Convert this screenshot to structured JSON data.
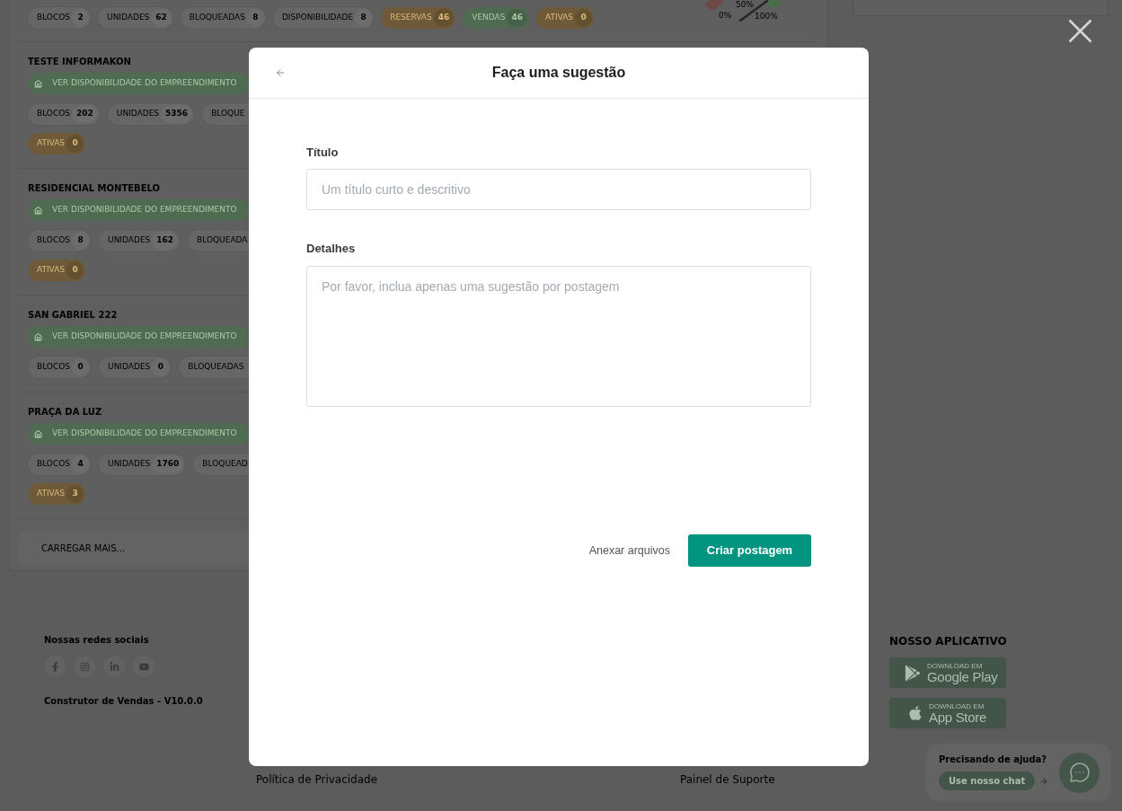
{
  "background_page": {
    "summary_chips": [
      {
        "label": "BLOCOS",
        "value": "2",
        "kind": "neutral"
      },
      {
        "label": "UNIDADES",
        "value": "62",
        "kind": "neutral"
      },
      {
        "label": "BLOQUEADAS",
        "value": "8",
        "kind": "neutral"
      },
      {
        "label": "DISPONIBILIDADE",
        "value": "8",
        "kind": "neutral"
      },
      {
        "label": "RESERVAS",
        "value": "46",
        "kind": "warning"
      },
      {
        "label": "VENDAS",
        "value": "46",
        "kind": "success"
      },
      {
        "label": "ATIVAS",
        "value": "0",
        "kind": "warning"
      }
    ],
    "gauge_labels": [
      "50%",
      "0%",
      "100%"
    ],
    "projects": [
      {
        "name": "TESTE INFORMAKON",
        "action": "VER DISPONIBILIDADE DO EMPREENDIMENTO",
        "chips": [
          {
            "label": "BLOCOS",
            "value": "202",
            "kind": "neutral"
          },
          {
            "label": "UNIDADES",
            "value": "5356",
            "kind": "neutral"
          },
          {
            "label": "BLOQUE",
            "kind": "neutral"
          }
        ],
        "status_chips": [
          {
            "label": "ATIVAS",
            "value": "0",
            "kind": "warning"
          }
        ]
      },
      {
        "name": "RESIDENCIAL MONTEBELO",
        "action": "VER DISPONIBILIDADE DO EMPREENDIMENTO",
        "chips": [
          {
            "label": "BLOCOS",
            "value": "8",
            "kind": "neutral"
          },
          {
            "label": "UNIDADES",
            "value": "162",
            "kind": "neutral"
          },
          {
            "label": "BLOQUEADA",
            "kind": "neutral"
          }
        ],
        "status_chips": [
          {
            "label": "ATIVAS",
            "value": "0",
            "kind": "warning"
          }
        ]
      },
      {
        "name": "SAN GABRIEL 222",
        "action": "VER DISPONIBILIDADE DO EMPREENDIMENTO",
        "chips": [
          {
            "label": "BLOCOS",
            "value": "0",
            "kind": "neutral"
          },
          {
            "label": "UNIDADES",
            "value": "0",
            "kind": "neutral"
          },
          {
            "label": "BLOQUEADAS",
            "kind": "neutral"
          }
        ]
      },
      {
        "name": "PRAÇA DA LUZ",
        "action": "VER DISPONIBILIDADE DO EMPREENDIMENTO",
        "chips": [
          {
            "label": "BLOCOS",
            "value": "4",
            "kind": "neutral"
          },
          {
            "label": "UNIDADES",
            "value": "1760",
            "kind": "neutral"
          },
          {
            "label": "BLOQUEAD",
            "kind": "neutral"
          }
        ],
        "status_chips": [
          {
            "label": "ATIVAS",
            "value": "3",
            "kind": "warning"
          }
        ]
      }
    ],
    "load_more": "CARREGAR MAIS..."
  },
  "footer": {
    "social_title": "Nossas redes sociais",
    "version": "Construtor de Vendas - V10.0.0",
    "app_title": "NOSSO APLICATIVO",
    "stores": [
      {
        "kind": "google_play",
        "caption": "DOWNLOAD EM",
        "name": "Google Play"
      },
      {
        "kind": "app_store",
        "caption": "DOWNLOAD EM",
        "name": "App Store"
      }
    ],
    "links": [
      "Política de Privacidade",
      "Painel de Suporte"
    ]
  },
  "chat_widget": {
    "prompt": "Precisando de ajuda?",
    "button": "Use nosso chat"
  },
  "modal": {
    "title": "Faça uma sugestão",
    "fields": [
      {
        "kind": "input",
        "label": "Título",
        "placeholder": "Um título curto e descritivo"
      },
      {
        "kind": "textarea",
        "label": "Detalhes",
        "placeholder": "Por favor, inclua apenas uma sugestão por postagem"
      }
    ],
    "attach_label": "Anexar arquivos",
    "submit_label": "Criar postagem"
  }
}
